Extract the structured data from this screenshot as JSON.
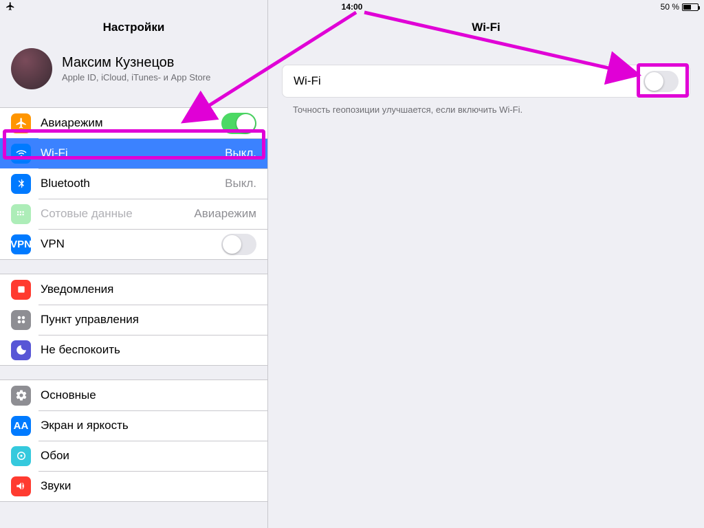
{
  "status": {
    "time": "14:00",
    "battery": "50 %"
  },
  "sidebar": {
    "title": "Настройки",
    "profile": {
      "name": "Максим Кузнецов",
      "sub": "Apple ID, iCloud, iTunes- и App Store"
    },
    "g1": {
      "airplane": "Авиарежим",
      "wifi": "Wi-Fi",
      "wifi_val": "Выкл.",
      "bt": "Bluetooth",
      "bt_val": "Выкл.",
      "cell": "Сотовые данные",
      "cell_val": "Авиарежим",
      "vpn": "VPN"
    },
    "g2": {
      "notif": "Уведомления",
      "cc": "Пункт управления",
      "dnd": "Не беспокоить"
    },
    "g3": {
      "general": "Основные",
      "display": "Экран и яркость",
      "wall": "Обои",
      "sound": "Звуки"
    }
  },
  "detail": {
    "title": "Wi-Fi",
    "row_label": "Wi-Fi",
    "footer": "Точность геопозиции улучшается, если включить Wi-Fi."
  },
  "icons": {
    "vpn": "VPN",
    "display": "AA"
  }
}
